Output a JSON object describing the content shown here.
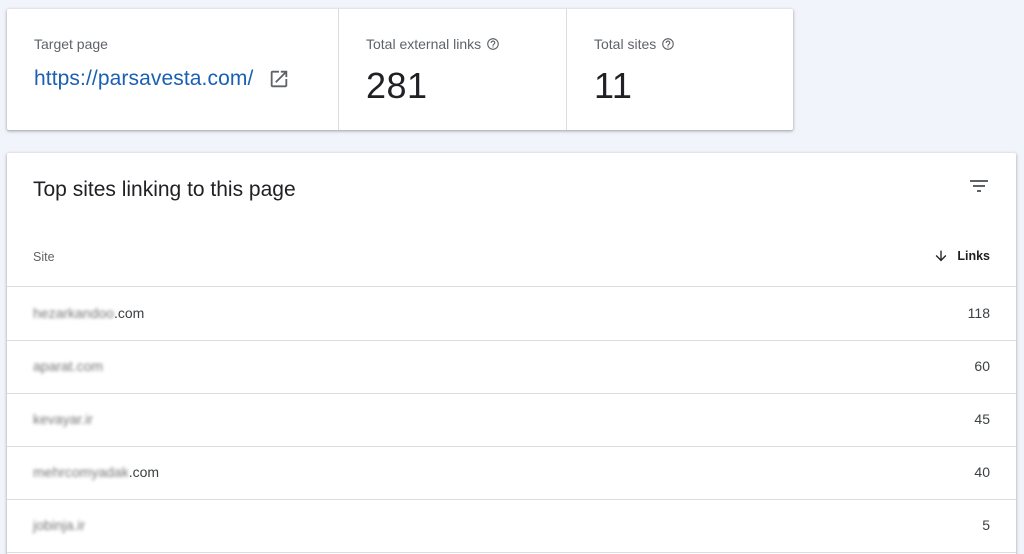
{
  "summary": {
    "target": {
      "label": "Target page",
      "url": "https://parsavesta.com/"
    },
    "external_links": {
      "label": "Total external links",
      "value": "281"
    },
    "total_sites": {
      "label": "Total sites",
      "value": "11"
    }
  },
  "table": {
    "title": "Top sites linking to this page",
    "columns": {
      "site": "Site",
      "links": "Links"
    },
    "rows": [
      {
        "site_blurred": "hezarkandoo",
        "site_tld": ".com",
        "links": "118"
      },
      {
        "site_blurred": "aparat.com",
        "site_tld": "",
        "links": "60"
      },
      {
        "site_blurred": "kevayar.ir",
        "site_tld": "",
        "links": "45"
      },
      {
        "site_blurred": "mehrcomyadak",
        "site_tld": ".com",
        "links": "40"
      },
      {
        "site_blurred": "jobinja.ir",
        "site_tld": "",
        "links": "5"
      }
    ]
  },
  "icons": {
    "help": "help-circle-icon",
    "open": "open-in-new-icon",
    "filter": "filter-list-icon",
    "sort": "arrow-downward-icon"
  },
  "colors": {
    "link": "#1a5fb4",
    "background": "#f1f4fb"
  }
}
